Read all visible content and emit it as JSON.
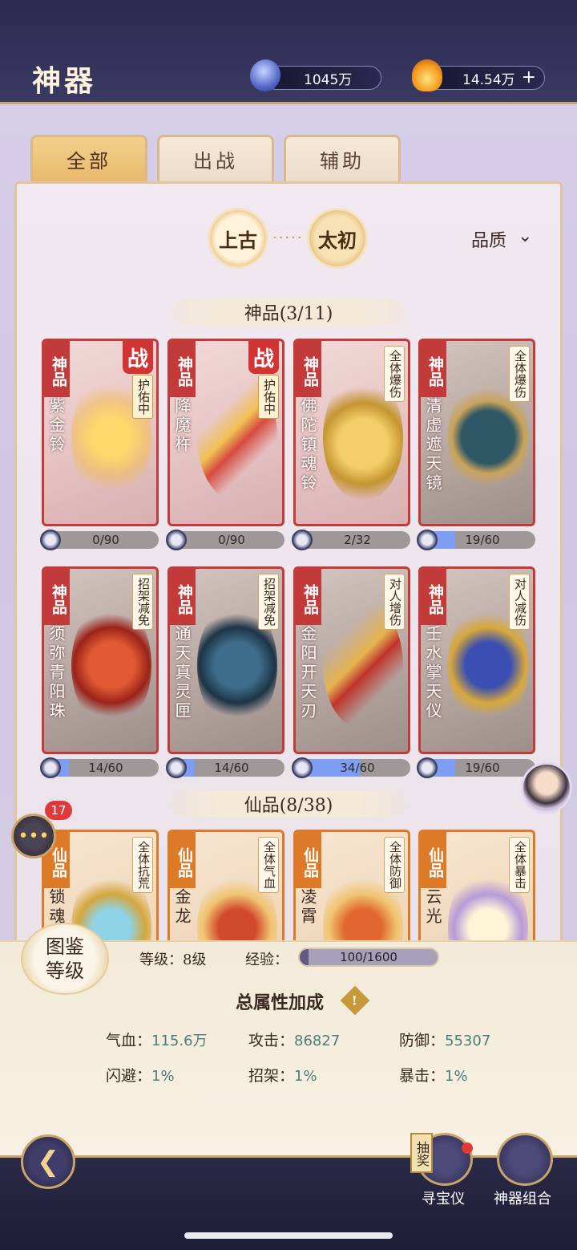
{
  "header": {
    "title": "神器",
    "currency1": {
      "icon": "gem-icon",
      "value": "1045万"
    },
    "currency2": {
      "icon": "flame-icon",
      "value": "14.54万",
      "add": "+"
    }
  },
  "tabs": [
    {
      "label": "全部",
      "active": true
    },
    {
      "label": "出战",
      "active": false
    },
    {
      "label": "辅助",
      "active": false
    }
  ],
  "eras": {
    "first": "上古",
    "second": "太初",
    "dots": "·····"
  },
  "filter": {
    "label": "品质",
    "icon": "chevron-down-icon"
  },
  "sections": {
    "divine": "神品(3/11)",
    "immortal": "仙品(8/38)"
  },
  "divine_items": [
    {
      "grade": "神品",
      "name": "紫金铃",
      "tag": "护佑中",
      "battle": "战",
      "progress": "0/90",
      "fill": 0
    },
    {
      "grade": "神品",
      "name": "降魔杵",
      "tag": "护佑中",
      "battle": "战",
      "progress": "0/90",
      "fill": 0
    },
    {
      "grade": "神品",
      "name": "佛陀镇魂铃",
      "tag": "全体爆伤",
      "battle": "",
      "progress": "2/32",
      "fill": 0.0625
    },
    {
      "grade": "神品",
      "name": "清虚遮天镜",
      "tag": "全体爆伤",
      "battle": "",
      "progress": "19/60",
      "fill": 0.3167
    },
    {
      "grade": "神品",
      "name": "须弥青阳珠",
      "tag": "招架减免",
      "battle": "",
      "progress": "14/60",
      "fill": 0.2333
    },
    {
      "grade": "神品",
      "name": "通天真灵匣",
      "tag": "招架减免",
      "battle": "",
      "progress": "14/60",
      "fill": 0.2333
    },
    {
      "grade": "神品",
      "name": "金阳开天刃",
      "tag": "对人增伤",
      "battle": "",
      "progress": "34/60",
      "fill": 0.5667
    },
    {
      "grade": "神品",
      "name": "壬水掌天仪",
      "tag": "对人减伤",
      "battle": "",
      "progress": "19/60",
      "fill": 0.3167
    }
  ],
  "immortal_items": [
    {
      "grade": "仙品",
      "name": "锁魂",
      "tag": "全体抗荒"
    },
    {
      "grade": "仙品",
      "name": "金龙",
      "tag": "全体气血"
    },
    {
      "grade": "仙品",
      "name": "凌霄",
      "tag": "全体防御"
    },
    {
      "grade": "仙品",
      "name": "云光",
      "tag": "全体暴击"
    }
  ],
  "chat": {
    "badge": "17"
  },
  "codex": {
    "label_line1": "图鉴",
    "label_line2": "等级",
    "level_label": "等级：",
    "level_value": "8级",
    "exp_label": "经验：",
    "exp_value": "100/1600",
    "exp_fill": 0.0625
  },
  "totals": {
    "title": "总属性加成",
    "hp_label": "气血：",
    "hp": "115.6万",
    "atk_label": "攻击：",
    "atk": "86827",
    "def_label": "防御：",
    "def": "55307",
    "dodge_label": "闪避：",
    "dodge": "1%",
    "parry_label": "招架：",
    "parry": "1%",
    "crit_label": "暴击：",
    "crit": "1%"
  },
  "bottom": {
    "lottery": "抽奖",
    "treasure": "寻宝仪",
    "combo": "神器组合"
  }
}
